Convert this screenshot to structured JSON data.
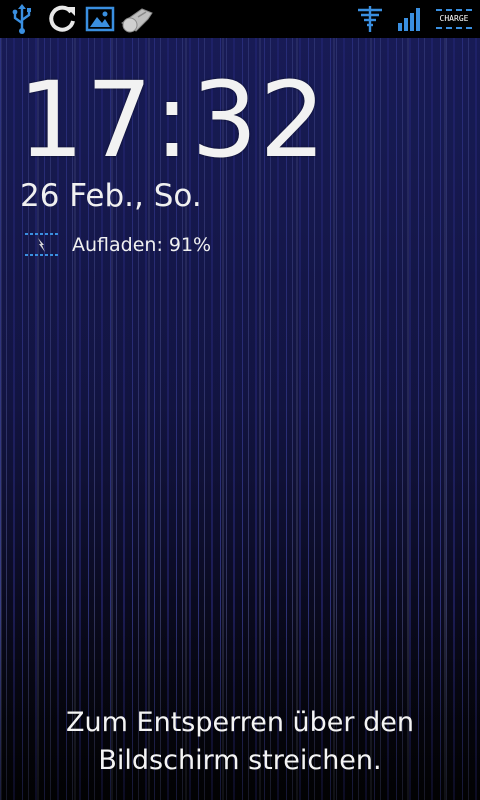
{
  "status_bar": {
    "left_icons": [
      "usb-icon",
      "sync-icon",
      "gallery-icon",
      "whistle-icon"
    ],
    "right_icons": [
      "wifi-icon",
      "signal-icon"
    ],
    "charge_label": "CHARGE",
    "accent_color": "#3a8fe0"
  },
  "lockscreen": {
    "time": "17:32",
    "date": "26 Feb., So.",
    "battery_status": "Aufladen: 91%",
    "unlock_hint_line1": "Zum Entsperren über den",
    "unlock_hint_line2": "Bildschirm streichen."
  }
}
